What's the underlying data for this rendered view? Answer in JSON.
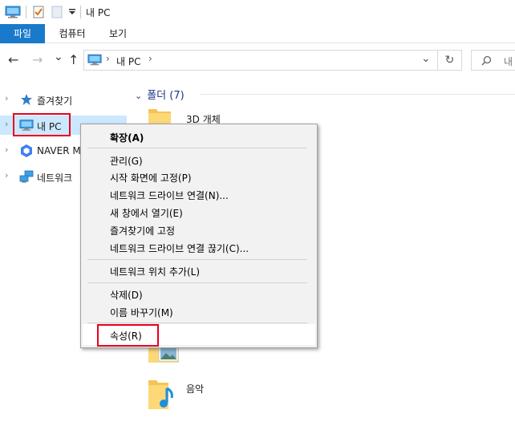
{
  "titlebar": {
    "title": "내 PC",
    "icons": [
      "computer-icon",
      "properties-checkbox-icon",
      "new-folder-icon",
      "customize-quick-access-dropdown"
    ]
  },
  "ribbon": {
    "tabs": [
      "파일",
      "컴퓨터",
      "보기"
    ],
    "file_color": "#1979ca"
  },
  "nav": {
    "back": "←",
    "forward": "→",
    "recent": "⌄",
    "up": "↑",
    "address": {
      "sep": "›",
      "location": "내 PC",
      "trail": "›",
      "dropdown": "⌄"
    },
    "refresh": "↻",
    "search_placeholder": "내"
  },
  "navpane": {
    "items": [
      {
        "label": "즐겨찾기",
        "icon": "star-icon"
      },
      {
        "label": "내 PC",
        "icon": "computer-icon",
        "selected": true
      },
      {
        "label": "NAVER MY",
        "icon": "naver-mybox-icon"
      },
      {
        "label": "네트워크",
        "icon": "network-icon"
      }
    ],
    "chevron": "›"
  },
  "content": {
    "group_header": "폴더 (7)",
    "group_chevron": "⌄",
    "folders": [
      {
        "label": "3D 개체"
      },
      {
        "label": "음악"
      }
    ]
  },
  "context_menu": {
    "items": [
      {
        "label": "확장(A)",
        "bold": true
      },
      {
        "label": "관리(G)"
      },
      {
        "label": "시작 화면에 고정(P)"
      },
      {
        "label": "네트워크 드라이브 연결(N)..."
      },
      {
        "label": "새 창에서 열기(E)"
      },
      {
        "label": "즐겨찾기에 고정"
      },
      {
        "label": "네트워크 드라이브 연결 끊기(C)..."
      },
      {
        "label": "네트워크 위치 추가(L)"
      },
      {
        "label": "삭제(D)"
      },
      {
        "label": "이름 바꾸기(M)"
      },
      {
        "label": "속성(R)"
      }
    ],
    "highlight_color": "#e8001c"
  }
}
